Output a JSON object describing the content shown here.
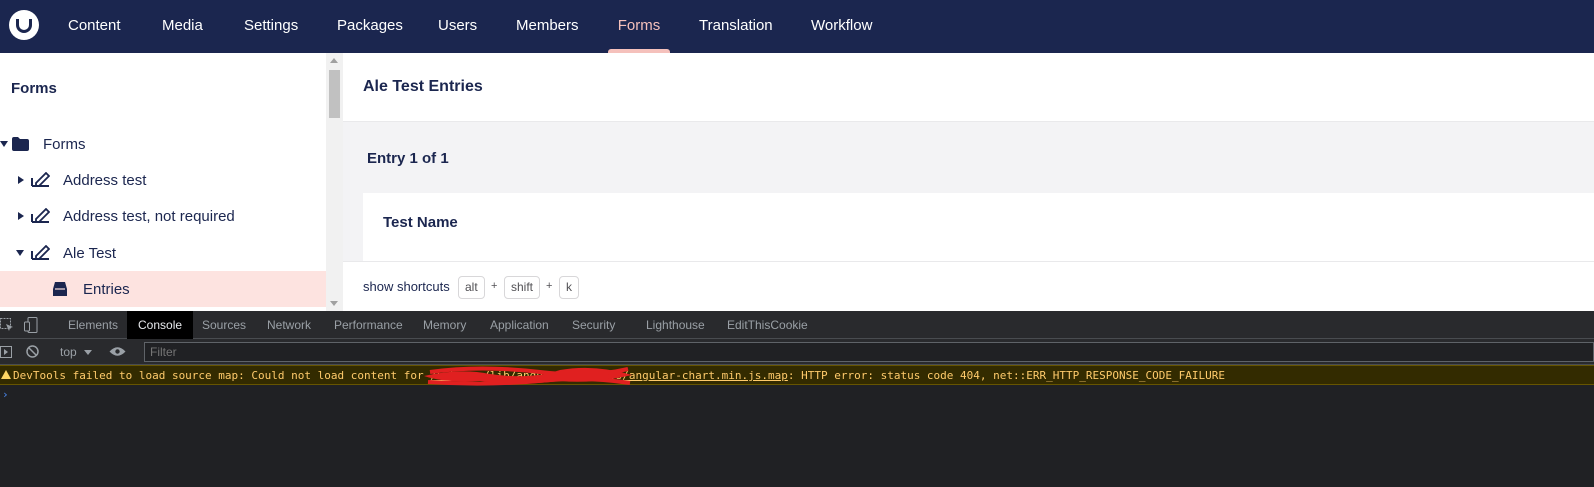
{
  "topnav": {
    "logo": "umbraco-logo",
    "items": [
      {
        "label": "Content",
        "active": false
      },
      {
        "label": "Media",
        "active": false
      },
      {
        "label": "Settings",
        "active": false
      },
      {
        "label": "Packages",
        "active": false
      },
      {
        "label": "Users",
        "active": false
      },
      {
        "label": "Members",
        "active": false
      },
      {
        "label": "Forms",
        "active": true
      },
      {
        "label": "Translation",
        "active": false
      },
      {
        "label": "Workflow",
        "active": false
      }
    ]
  },
  "sidebar": {
    "title": "Forms",
    "tree": [
      {
        "label": "Forms",
        "icon": "folder-icon",
        "expanded": true
      },
      {
        "label": "Address test",
        "icon": "form-icon",
        "expanded": false
      },
      {
        "label": "Address test, not required",
        "icon": "form-icon",
        "expanded": false
      },
      {
        "label": "Ale Test",
        "icon": "form-icon",
        "expanded": true
      },
      {
        "label": "Entries",
        "icon": "inbox-icon",
        "selected": true
      }
    ]
  },
  "main": {
    "title": "Ale Test Entries",
    "entry_count": "Entry 1 of 1",
    "field_name": "Test Name",
    "shortcuts": {
      "label": "show shortcuts",
      "keys": [
        "alt",
        "shift",
        "k"
      ],
      "separator": "+"
    }
  },
  "devtools": {
    "tabs": [
      {
        "label": "Elements",
        "active": false
      },
      {
        "label": "Console",
        "active": true
      },
      {
        "label": "Sources",
        "active": false
      },
      {
        "label": "Network",
        "active": false
      },
      {
        "label": "Performance",
        "active": false
      },
      {
        "label": "Memory",
        "active": false
      },
      {
        "label": "Application",
        "active": false
      },
      {
        "label": "Security",
        "active": false
      },
      {
        "label": "Lighthouse",
        "active": false
      },
      {
        "label": "EditThisCookie",
        "active": false
      }
    ],
    "context": "top",
    "filter_placeholder": "Filter",
    "warning": {
      "prefix": "DevTools failed to load source map: Could not load content for ",
      "link": "/umbraco/lib/angular-chart.js/angular-chart.min.js.map",
      "suffix": ": HTTP error: status code 404, net::ERR_HTTP_RESPONSE_CODE_FAILURE"
    },
    "prompt": "›",
    "colors": {
      "warning_text": "#ffcb6b",
      "warning_bg": "#332b00",
      "redaction": "#e02020"
    }
  },
  "colors": {
    "nav_bg": "#1b264f",
    "nav_active": "#f5c1bc",
    "selected_row": "#fde3e0",
    "text_primary": "#1b264f"
  }
}
